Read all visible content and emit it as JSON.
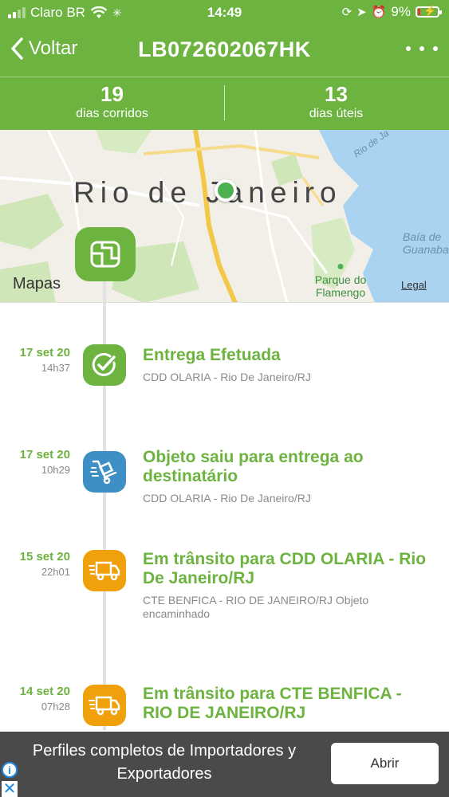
{
  "status_bar": {
    "carrier": "Claro BR",
    "time": "14:49",
    "battery": "9%"
  },
  "nav": {
    "back_label": "Voltar",
    "title": "LB072602067HK"
  },
  "days": {
    "calendar_count": "19",
    "calendar_label": "dias corridos",
    "business_count": "13",
    "business_label": "dias úteis"
  },
  "map": {
    "city_label": "Rio de Janeiro",
    "park_label": "Parque do Flamengo",
    "bay_label": "Baía de Guanabara",
    "road_label": "Rio de Ja",
    "brand": "Mapas",
    "legal": "Legal"
  },
  "events": [
    {
      "date": "17 set 20",
      "time": "14h37",
      "title": "Entrega Efetuada",
      "location": "CDD OLARIA - Rio De Janeiro/RJ",
      "icon": "check-icon",
      "color": "#6cb33f"
    },
    {
      "date": "17 set 20",
      "time": "10h29",
      "title": "Objeto saiu para entrega ao destinatário",
      "location": "CDD OLARIA - Rio De Janeiro/RJ",
      "icon": "hand-truck-icon",
      "color": "#3d8fc6"
    },
    {
      "date": "15 set 20",
      "time": "22h01",
      "title": "Em trânsito para CDD OLARIA - Rio De Janeiro/RJ",
      "location": "CTE BENFICA - RIO DE JANEIRO/RJ Objeto encaminhado",
      "icon": "truck-icon",
      "color": "#f0a00a"
    },
    {
      "date": "14 set 20",
      "time": "07h28",
      "title": "Em trânsito para CTE BENFICA - RIO DE JANEIRO/RJ",
      "location": "",
      "icon": "truck-icon",
      "color": "#f0a00a"
    }
  ],
  "ad": {
    "text": "Perfiles completos de Importadores y Exportadores",
    "button": "Abrir"
  },
  "colors": {
    "brand_green": "#6cb33f",
    "blue_status": "#3d8fc6",
    "orange_status": "#f0a00a"
  }
}
